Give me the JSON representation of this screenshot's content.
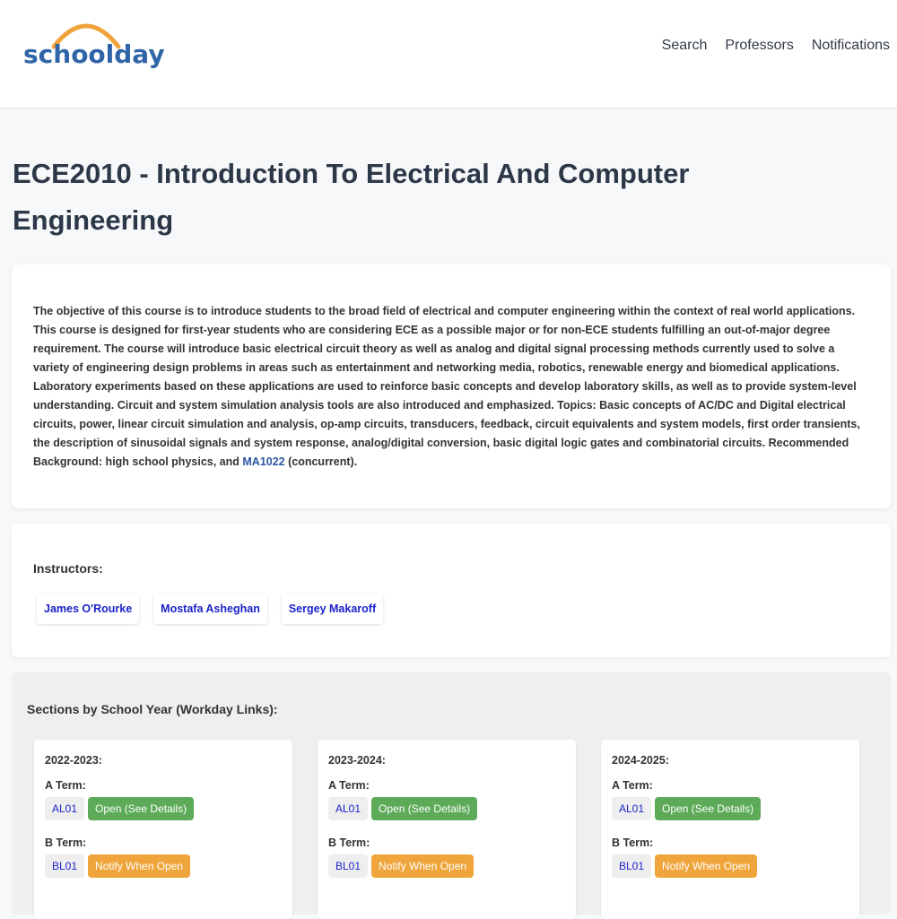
{
  "header": {
    "logo_text": "schoolday",
    "nav": [
      "Search",
      "Professors",
      "Notifications"
    ]
  },
  "course": {
    "title": "ECE2010 - Introduction To Electrical And Computer Engineering",
    "description_before_link": "The objective of this course is to introduce students to the broad field of electrical and computer engineering within the context of real world applications. This course is designed for first-year students who are considering ECE as a possible major or for non-ECE students fulfilling an out-of-major degree requirement. The course will introduce basic electrical circuit theory as well as analog and digital signal processing methods currently used to solve a variety of engineering design problems in areas such as entertainment and networking media, robotics, renewable energy and biomedical applications. Laboratory experiments based on these applications are used to reinforce basic concepts and develop laboratory skills, as well as to provide system-level understanding. Circuit and system simulation analysis tools are also introduced and emphasized. Topics: Basic concepts of AC/DC and Digital electrical circuits, power, linear circuit simulation and analysis, op-amp circuits, transducers, feedback, circuit equivalents and system models, first order transients, the description of sinusoidal signals and system response, analog/digital conversion, basic digital logic gates and combinatorial circuits. Recommended Background: high school physics, and ",
    "description_link": "MA1022",
    "description_after_link": " (concurrent)."
  },
  "instructors": {
    "heading": "Instructors:",
    "names": [
      "James O'Rourke",
      "Mostafa Asheghan",
      "Sergey Makaroff"
    ]
  },
  "sections": {
    "heading": "Sections by School Year (Workday Links):",
    "years": [
      {
        "year": "2022-2023:",
        "terms": [
          {
            "label": "A Term:",
            "code": "AL01",
            "status": "Open (See Details)",
            "status_type": "open"
          },
          {
            "label": "B Term:",
            "code": "BL01",
            "status": "Notify When Open",
            "status_type": "notify"
          }
        ]
      },
      {
        "year": "2023-2024:",
        "terms": [
          {
            "label": "A Term:",
            "code": "AL01",
            "status": "Open (See Details)",
            "status_type": "open"
          },
          {
            "label": "B Term:",
            "code": "BL01",
            "status": "Notify When Open",
            "status_type": "notify"
          }
        ]
      },
      {
        "year": "2024-2025:",
        "terms": [
          {
            "label": "A Term:",
            "code": "AL01",
            "status": "Open (See Details)",
            "status_type": "open"
          },
          {
            "label": "B Term:",
            "code": "BL01",
            "status": "Notify When Open",
            "status_type": "notify"
          }
        ]
      }
    ]
  },
  "colors": {
    "logo_blue": "#2f65a8",
    "logo_arc_orange": "#f0a33a",
    "open_green": "#5dab59",
    "notify_orange": "#efa53c",
    "link_blue": "#1a23c9"
  }
}
